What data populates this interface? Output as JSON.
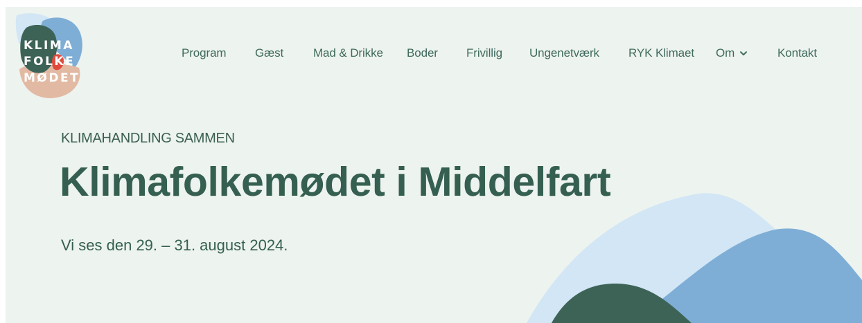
{
  "brand": {
    "logo_lines": [
      "KLIMA",
      "FOLKE",
      "MØDET"
    ],
    "colors": {
      "dark_green": "#3d6356",
      "light_blue": "#d2e6f5",
      "mid_blue": "#7eaed6",
      "peach": "#e2b9a2",
      "red": "#e04a3c",
      "background": "#edf3ef"
    }
  },
  "nav": {
    "items": [
      {
        "label": "Program"
      },
      {
        "label": "Gæst"
      },
      {
        "label": "Mad & Drikke"
      },
      {
        "label": "Boder"
      },
      {
        "label": "Frivillig"
      },
      {
        "label": "Ungenetværk"
      },
      {
        "label": "RYK Klimaet"
      },
      {
        "label": "Om"
      },
      {
        "label": "Kontakt"
      }
    ],
    "dropdown_icon": "chevron-down-icon"
  },
  "hero": {
    "eyebrow": "KLIMAHANDLING SAMMEN",
    "title": "Klimafolkemødet i Middelfart",
    "subtitle": "Vi ses den 29. – 31. august 2024."
  }
}
